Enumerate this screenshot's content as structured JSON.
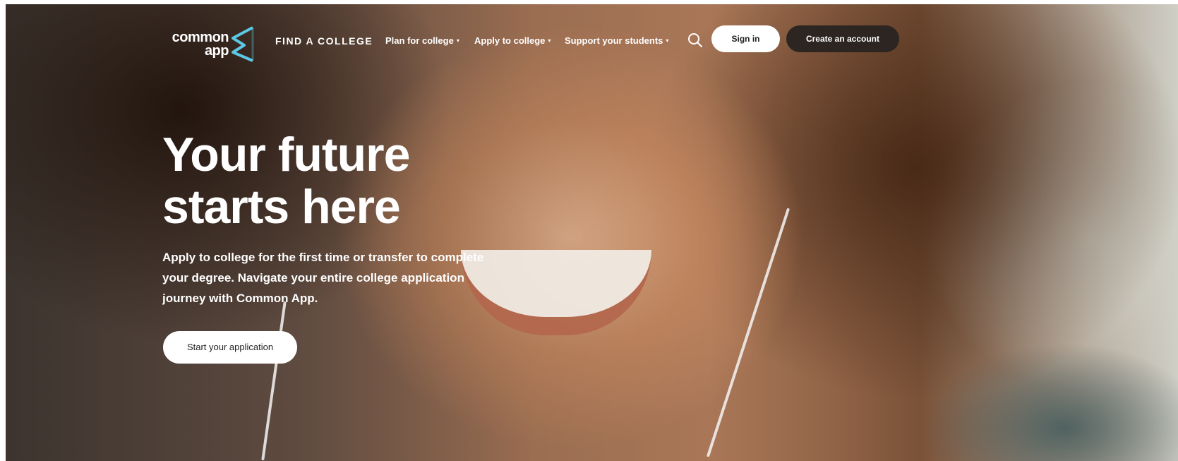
{
  "brand": {
    "logo_line1": "common",
    "logo_line2": "app",
    "accent_color": "#5bc8e6"
  },
  "nav": {
    "find_college": "FIND A COLLEGE",
    "items": [
      {
        "label": "Plan for college",
        "caret": "▾"
      },
      {
        "label": "Apply to college",
        "caret": "▾"
      },
      {
        "label": "Support your students",
        "caret": "▾"
      }
    ],
    "search_icon": "search-icon",
    "sign_in": "Sign in",
    "create_account": "Create an account"
  },
  "hero": {
    "headline_line1": "Your future",
    "headline_line2": "starts here",
    "subtext": "Apply to college for the first time or transfer to complete your degree. Navigate your entire college application journey with Common App.",
    "cta": "Start your application",
    "image_alt": "photo-smiling-student-with-earphones"
  }
}
